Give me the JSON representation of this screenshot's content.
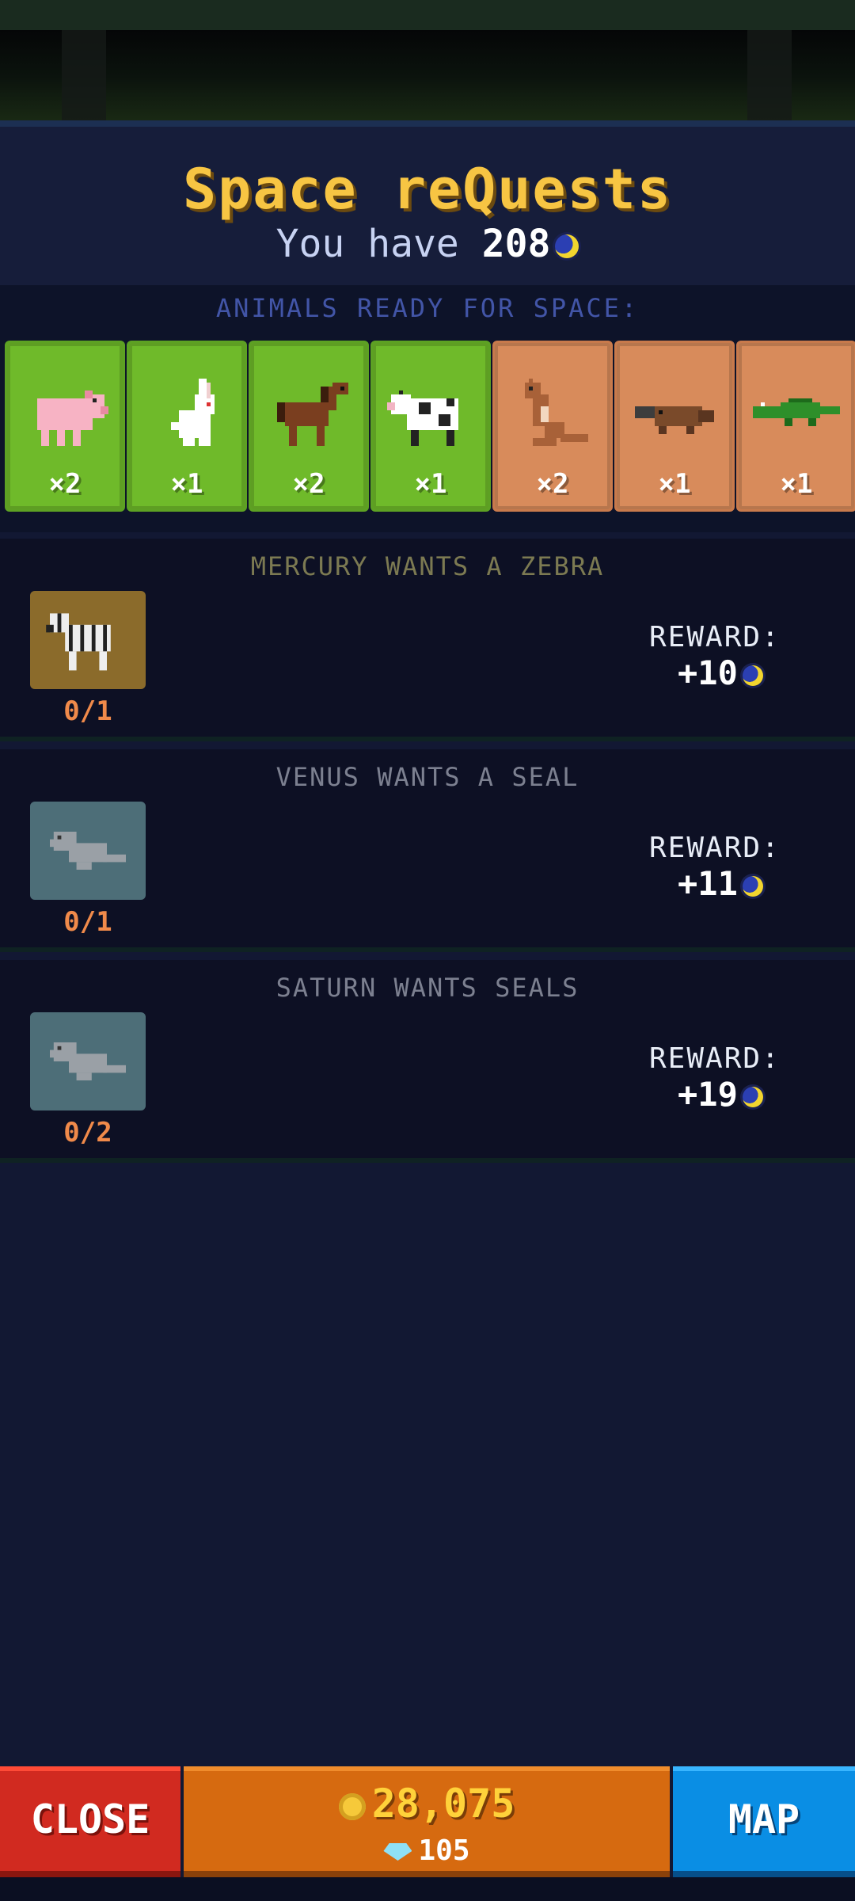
{
  "header": {
    "title": "Space reQuests",
    "balance_prefix": "You have",
    "balance_value": "208",
    "currency_icon": "moon-token-icon"
  },
  "animals": {
    "label": "ANIMALS READY FOR SPACE:",
    "cards": [
      {
        "name": "pig",
        "count": "×2",
        "bg": "green"
      },
      {
        "name": "rabbit",
        "count": "×1",
        "bg": "green"
      },
      {
        "name": "horse",
        "count": "×2",
        "bg": "green"
      },
      {
        "name": "cow",
        "count": "×1",
        "bg": "green"
      },
      {
        "name": "kangaroo",
        "count": "×2",
        "bg": "tan"
      },
      {
        "name": "platypus",
        "count": "×1",
        "bg": "tan"
      },
      {
        "name": "crocodile",
        "count": "×1",
        "bg": "tan"
      }
    ]
  },
  "quests": [
    {
      "title": "MERCURY WANTS A ZEBRA",
      "animal": "zebra",
      "progress": "0/1",
      "reward_label": "REWARD:",
      "reward_amount": "+10"
    },
    {
      "title": "VENUS WANTS A SEAL",
      "animal": "seal",
      "progress": "0/1",
      "reward_label": "REWARD:",
      "reward_amount": "+11"
    },
    {
      "title": "SATURN WANTS SEALS",
      "animal": "seal",
      "progress": "0/2",
      "reward_label": "REWARD:",
      "reward_amount": "+19"
    }
  ],
  "bottom": {
    "close_label": "CLOSE",
    "coins": "28,075",
    "gems": "105",
    "map_label": "MAP"
  },
  "colors": {
    "title": "#f7c543",
    "green_card": "#6fba2a",
    "tan_card": "#d88b5b",
    "close": "#d12a20",
    "map": "#0a8ee4",
    "center": "#d66a10"
  }
}
